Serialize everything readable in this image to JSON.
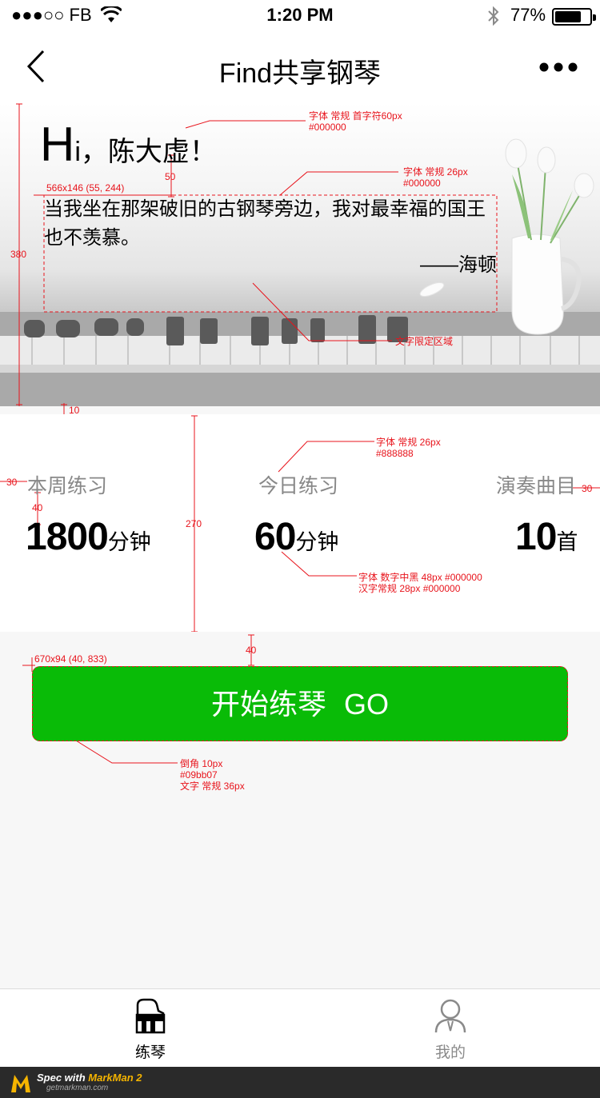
{
  "status_bar": {
    "carrier": "●●●○○ FB",
    "time": "1:20 PM",
    "battery_text": "77%",
    "battery_level": 0.77
  },
  "nav": {
    "title": "Find共享钢琴"
  },
  "hero": {
    "greeting_initial": "H",
    "greeting_rest": "i，陈大虚！",
    "quote": "当我坐在那架破旧的古钢琴旁边，我对最幸福的国王也不羡慕。",
    "quote_author": "——海顿"
  },
  "specs": {
    "greeting_font": "字体 常规 首字符60px",
    "greeting_color": "#000000",
    "quote_font": "字体 常规 26px",
    "quote_color": "#000000",
    "quote_box": "566x146 (55, 244)",
    "text_area": "文字限定区域",
    "gap_50": "50",
    "height_380": "380",
    "gap_10": "10",
    "label_font": "字体 常规 26px",
    "label_color": "#888888",
    "margin_left": "30",
    "margin_right": "30",
    "gap_40": "40",
    "height_270": "270",
    "value_font": "字体 数字中黑 48px #000000",
    "unit_font": "汉字常规 28px #000000",
    "gap_40_btn": "40",
    "button_box": "670x94 (40, 833)",
    "button_radius": "倒角 10px",
    "button_color": "#09bb07",
    "button_font": "文字 常规 36px"
  },
  "stats": [
    {
      "label": "本周练习",
      "value": "1800",
      "unit": "分钟"
    },
    {
      "label": "今日练习",
      "value": "60",
      "unit": "分钟"
    },
    {
      "label": "演奏曲目",
      "value": "10",
      "unit": "首"
    }
  ],
  "start_button": {
    "label": "开始练琴",
    "go": "GO",
    "color": "#09bb07"
  },
  "tabs": [
    {
      "label": "练琴",
      "icon": "piano-icon",
      "active": true
    },
    {
      "label": "我的",
      "icon": "user-icon",
      "active": false
    }
  ],
  "watermark": {
    "brand_prefix": "Spec with ",
    "brand_name": "MarkMan 2",
    "site": "getmarkman.com"
  }
}
